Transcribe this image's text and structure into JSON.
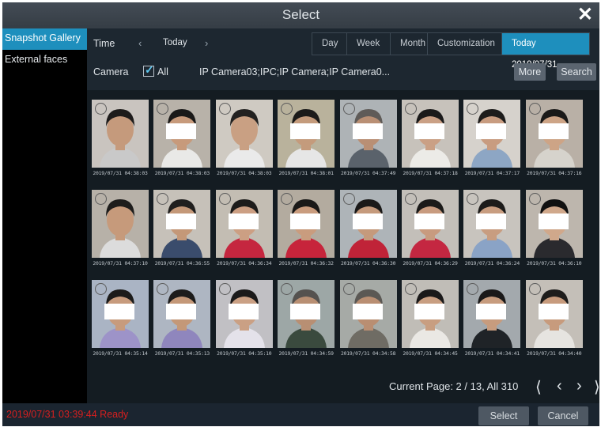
{
  "window": {
    "title": "Select",
    "close_icon": "close-icon"
  },
  "sidebar": {
    "items": [
      {
        "label": "Snapshot Gallery",
        "active": true
      },
      {
        "label": "External faces",
        "active": false
      }
    ]
  },
  "filters": {
    "time_label": "Time",
    "time_value": "Today",
    "prev_icon": "chevron-left-icon",
    "next_icon": "chevron-right-icon",
    "range_tabs": [
      {
        "label": "Day",
        "active": false
      },
      {
        "label": "Week",
        "active": false
      },
      {
        "label": "Month",
        "active": false
      },
      {
        "label": "Customization",
        "active": false
      },
      {
        "label": "Today 2019/07/31",
        "active": true
      }
    ],
    "camera_label": "Camera",
    "all_label": "All",
    "all_checked": true,
    "camera_list": "IP Camera03;IPC;IP Camera;IP Camera0...",
    "more_label": "More",
    "search_label": "Search"
  },
  "gallery": {
    "rows": [
      [
        {
          "timestamp": "2019/07/31 04:38:03",
          "bg": "#c9c4bf",
          "skin": "#c59a7c",
          "hair": "#1e1c1b",
          "shirt": "#c9c9c9",
          "redacted": false
        },
        {
          "timestamp": "2019/07/31 04:38:03",
          "bg": "#b8b2a9",
          "skin": "#c79a7b",
          "hair": "#1a1918",
          "shirt": "#e9e9e7",
          "redacted": true
        },
        {
          "timestamp": "2019/07/31 04:38:03",
          "bg": "#cfcac2",
          "skin": "#c9a083",
          "hair": "#222120",
          "shirt": "#eaeaea",
          "redacted": false
        },
        {
          "timestamp": "2019/07/31 04:38:01",
          "bg": "#b9b29c",
          "skin": "#c49b7c",
          "hair": "#1c1b1a",
          "shirt": "#e6e6e6",
          "redacted": true
        },
        {
          "timestamp": "2019/07/31 04:37:49",
          "bg": "#aeb3b6",
          "skin": "#b98f74",
          "hair": "#5f5b58",
          "shirt": "#5a626b",
          "redacted": true
        },
        {
          "timestamp": "2019/07/31 04:37:18",
          "bg": "#c7c2bb",
          "skin": "#caa085",
          "hair": "#1b1a1a",
          "shirt": "#ecebe7",
          "redacted": true
        },
        {
          "timestamp": "2019/07/31 04:37:17",
          "bg": "#d6d2cc",
          "skin": "#c89c80",
          "hair": "#1d1c1b",
          "shirt": "#8da6c4",
          "redacted": true
        },
        {
          "timestamp": "2019/07/31 04:37:16",
          "bg": "#b9b0a6",
          "skin": "#cda486",
          "hair": "#1a1918",
          "shirt": "#d6d3cc",
          "redacted": true
        }
      ],
      [
        {
          "timestamp": "2019/07/31 04:37:10",
          "bg": "#b7b1a8",
          "skin": "#c69a7b",
          "hair": "#1e1d1c",
          "shirt": "#dcdcdc",
          "redacted": false
        },
        {
          "timestamp": "2019/07/31 04:36:55",
          "bg": "#c6c1b9",
          "skin": "#c49878",
          "hair": "#201f1e",
          "shirt": "#3a4c6c",
          "redacted": true
        },
        {
          "timestamp": "2019/07/31 04:36:34",
          "bg": "#c3bdb3",
          "skin": "#cc9f83",
          "hair": "#1d1c1b",
          "shirt": "#c5263f",
          "redacted": true
        },
        {
          "timestamp": "2019/07/31 04:36:32",
          "bg": "#b3ab9f",
          "skin": "#c99c7e",
          "hair": "#1a1918",
          "shirt": "#c7243b",
          "redacted": true
        },
        {
          "timestamp": "2019/07/31 04:36:30",
          "bg": "#aeb4b8",
          "skin": "#c59a7c",
          "hair": "#1b1a19",
          "shirt": "#c02338",
          "redacted": true
        },
        {
          "timestamp": "2019/07/31 04:36:29",
          "bg": "#c3bfb9",
          "skin": "#c89b7f",
          "hair": "#1b1a19",
          "shirt": "#c42741",
          "redacted": true
        },
        {
          "timestamp": "2019/07/31 04:36:24",
          "bg": "#c8c4be",
          "skin": "#c89d80",
          "hair": "#1c1b1a",
          "shirt": "#8aa3c6",
          "redacted": true
        },
        {
          "timestamp": "2019/07/31 04:36:10",
          "bg": "#bdb6ad",
          "skin": "#d0a88b",
          "hair": "#111111",
          "shirt": "#2a2a2e",
          "redacted": true
        }
      ],
      [
        {
          "timestamp": "2019/07/31 04:35:14",
          "bg": "#aab4c4",
          "skin": "#c79b7d",
          "hair": "#1c1b1a",
          "shirt": "#9d93c8",
          "redacted": true
        },
        {
          "timestamp": "2019/07/31 04:35:13",
          "bg": "#aeb6c2",
          "skin": "#c49878",
          "hair": "#1d1c1b",
          "shirt": "#8f86bd",
          "redacted": true
        },
        {
          "timestamp": "2019/07/31 04:35:10",
          "bg": "#c1c0c4",
          "skin": "#caa084",
          "hair": "#1b1a1a",
          "shirt": "#e4e2ea",
          "redacted": true
        },
        {
          "timestamp": "2019/07/31 04:34:59",
          "bg": "#9da7a6",
          "skin": "#b88f73",
          "hair": "#55524f",
          "shirt": "#3a4a3e",
          "redacted": true
        },
        {
          "timestamp": "2019/07/31 04:34:58",
          "bg": "#a6aaa6",
          "skin": "#b98e72",
          "hair": "#5b5854",
          "shirt": "#6f6c64",
          "redacted": true
        },
        {
          "timestamp": "2019/07/31 04:34:45",
          "bg": "#c0bdb7",
          "skin": "#c89e81",
          "hair": "#1a1919",
          "shirt": "#eae8e4",
          "redacted": true
        },
        {
          "timestamp": "2019/07/31 04:34:41",
          "bg": "#a3a9ad",
          "skin": "#c79c7e",
          "hair": "#1a1919",
          "shirt": "#1f2327",
          "redacted": true
        },
        {
          "timestamp": "2019/07/31 04:34:40",
          "bg": "#c4bfb8",
          "skin": "#c79b7d",
          "hair": "#1e1d1c",
          "shirt": "#e6e4e0",
          "redacted": true
        }
      ]
    ]
  },
  "pager": {
    "text": "Current Page: 2 / 13, All 310",
    "first_icon": "first-page-icon",
    "prev_icon": "prev-page-icon",
    "next_icon": "next-page-icon",
    "last_icon": "last-page-icon"
  },
  "footer": {
    "status": "2019/07/31 03:39:44 Ready",
    "select_label": "Select",
    "cancel_label": "Cancel"
  }
}
